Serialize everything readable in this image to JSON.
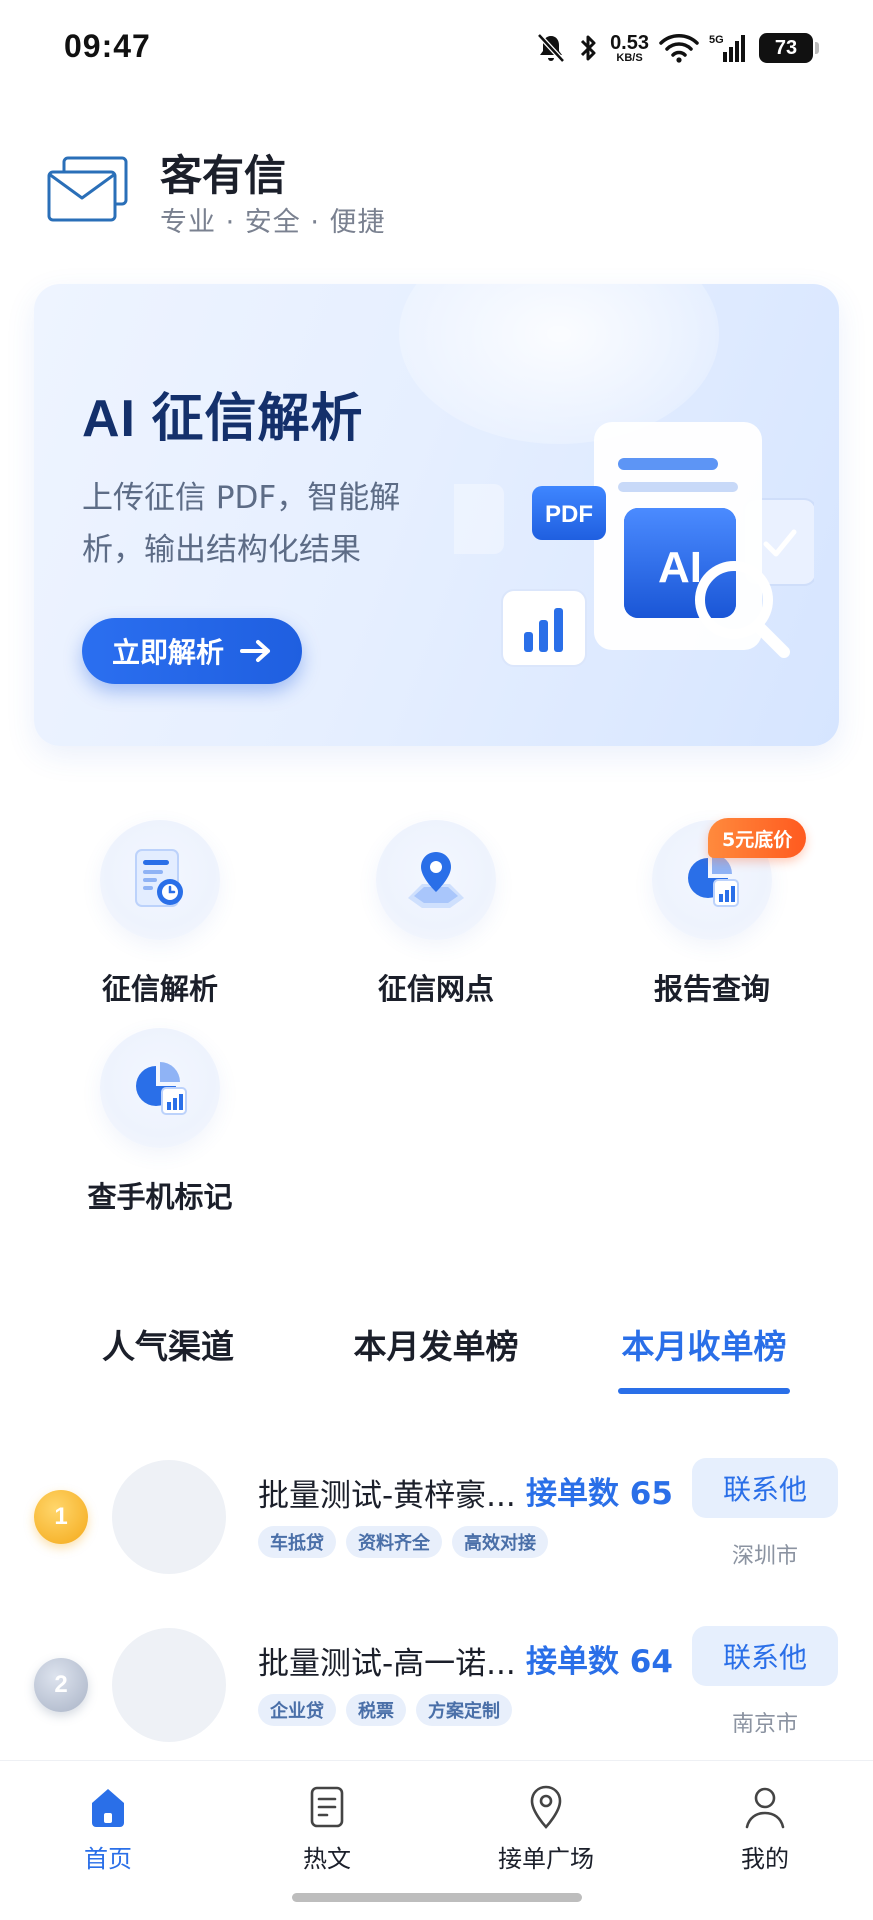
{
  "status_bar": {
    "time": "09:47",
    "net_speed_value": "0.53",
    "net_speed_unit": "KB/S",
    "signal_label": "5G",
    "battery_level": "73",
    "icons": [
      "mute-icon",
      "bluetooth-icon",
      "wifi-icon",
      "signal-icon",
      "battery-icon"
    ]
  },
  "brand": {
    "name": "客有信",
    "slogan": "专业 · 安全 · 便捷",
    "logo_icon": "envelope-icon"
  },
  "banner": {
    "title": "AI 征信解析",
    "description": "上传征信 PDF，智能解析，输出结构化结果",
    "button_label": "立即解析",
    "illustration_labels": {
      "pdf": "PDF",
      "ai": "AI"
    }
  },
  "quick_entries": [
    {
      "label": "征信解析",
      "icon": "credit-report-icon"
    },
    {
      "label": "征信网点",
      "icon": "map-pin-icon"
    },
    {
      "label": "报告查询",
      "icon": "pie-chart-icon",
      "badge": "5元底价"
    },
    {
      "label": "查手机标记",
      "icon": "pie-chart-icon"
    }
  ],
  "tabs": [
    {
      "label": "人气渠道",
      "active": false
    },
    {
      "label": "本月发单榜",
      "active": false
    },
    {
      "label": "本月收单榜",
      "active": true
    }
  ],
  "ranking": [
    {
      "rank": "1",
      "name": "批量测试-黄梓豪...",
      "count_text": "接单数 65",
      "tags": [
        "车抵贷",
        "资料齐全",
        "高效对接"
      ],
      "contact_label": "联系他",
      "city": "深圳市"
    },
    {
      "rank": "2",
      "name": "批量测试-高一诺...",
      "count_text": "接单数 64",
      "tags": [
        "企业贷",
        "税票",
        "方案定制"
      ],
      "contact_label": "联系他",
      "city": "南京市"
    }
  ],
  "bottom_nav": [
    {
      "label": "首页",
      "icon": "home-icon",
      "active": true
    },
    {
      "label": "热文",
      "icon": "article-icon",
      "active": false
    },
    {
      "label": "接单广场",
      "icon": "location-icon",
      "active": false
    },
    {
      "label": "我的",
      "icon": "user-icon",
      "active": false
    }
  ],
  "colors": {
    "accent": "#2a6fe8",
    "badge_orange": "#ff5a1f",
    "gold_medal": "#f4a91a",
    "silver_medal": "#a9b3c6",
    "text_primary": "#1b1f2a",
    "text_secondary": "#7a8190"
  }
}
